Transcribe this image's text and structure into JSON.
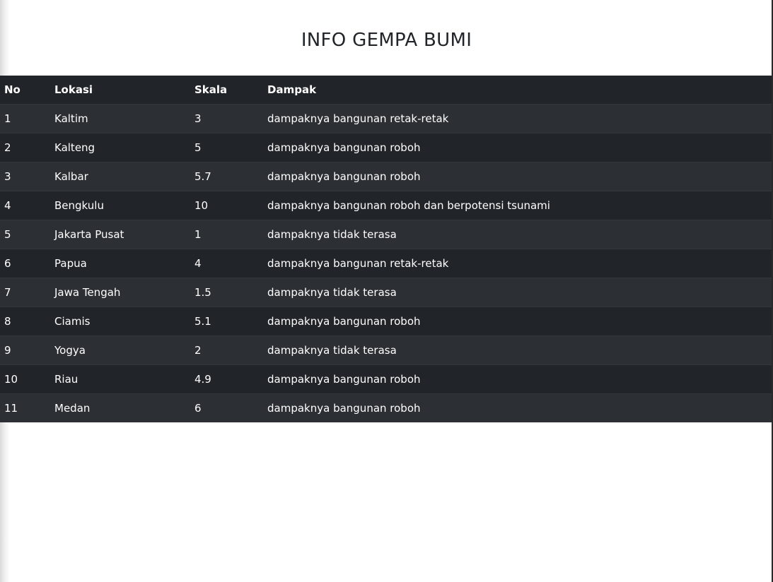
{
  "page": {
    "title": "INFO GEMPA BUMI"
  },
  "table": {
    "headers": {
      "no": "No",
      "lokasi": "Lokasi",
      "skala": "Skala",
      "dampak": "Dampak"
    },
    "rows": [
      {
        "no": "1",
        "lokasi": "Kaltim",
        "skala": "3",
        "dampak": "dampaknya bangunan retak-retak"
      },
      {
        "no": "2",
        "lokasi": "Kalteng",
        "skala": "5",
        "dampak": "dampaknya bangunan roboh"
      },
      {
        "no": "3",
        "lokasi": "Kalbar",
        "skala": "5.7",
        "dampak": "dampaknya bangunan roboh"
      },
      {
        "no": "4",
        "lokasi": "Bengkulu",
        "skala": "10",
        "dampak": "dampaknya bangunan roboh dan berpotensi tsunami"
      },
      {
        "no": "5",
        "lokasi": "Jakarta Pusat",
        "skala": "1",
        "dampak": "dampaknya tidak terasa"
      },
      {
        "no": "6",
        "lokasi": "Papua",
        "skala": "4",
        "dampak": "dampaknya bangunan retak-retak"
      },
      {
        "no": "7",
        "lokasi": "Jawa Tengah",
        "skala": "1.5",
        "dampak": "dampaknya tidak terasa"
      },
      {
        "no": "8",
        "lokasi": "Ciamis",
        "skala": "5.1",
        "dampak": "dampaknya bangunan roboh"
      },
      {
        "no": "9",
        "lokasi": "Yogya",
        "skala": "2",
        "dampak": "dampaknya tidak terasa"
      },
      {
        "no": "10",
        "lokasi": "Riau",
        "skala": "4.9",
        "dampak": "dampaknya bangunan roboh"
      },
      {
        "no": "11",
        "lokasi": "Medan",
        "skala": "6",
        "dampak": "dampaknya bangunan roboh"
      }
    ]
  },
  "colors": {
    "header_bg": "#212529",
    "row_odd_bg": "#2c3034",
    "row_even_bg": "#212529",
    "text_light": "#ffffff",
    "title_text": "#212529"
  }
}
